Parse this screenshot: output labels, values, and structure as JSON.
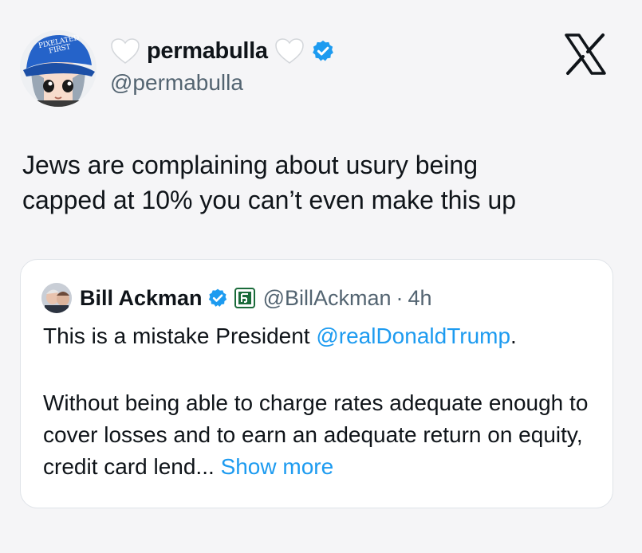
{
  "tweet": {
    "display_name": "permabulla",
    "handle": "@permabulla",
    "avatar_hat_text": "PIXELATED FIRST",
    "text": "Jews are complaining about usury being\ncapped at 10% you can’t even make this up"
  },
  "quote": {
    "display_name": "Bill Ackman",
    "handle": "@BillAckman",
    "separator": "·",
    "time": "4h",
    "line1_prefix": "This is a mistake President ",
    "line1_mention": "@realDonaldTrump",
    "line1_suffix": ".",
    "body": "Without being able to charge rates adequate enough to cover losses and to earn an adequate return on equity, credit card lend...",
    "show_more": "Show more"
  },
  "colors": {
    "accent": "#1d9bf0",
    "secondary_text": "#536471",
    "verified": "#1d9bf0",
    "affiliate_badge": "#1a6b3a"
  },
  "icons": {
    "heart": "white-heart-icon",
    "verified": "verified-badge-icon",
    "x_logo": "x-logo-icon",
    "affiliate": "affiliate-badge-icon"
  }
}
